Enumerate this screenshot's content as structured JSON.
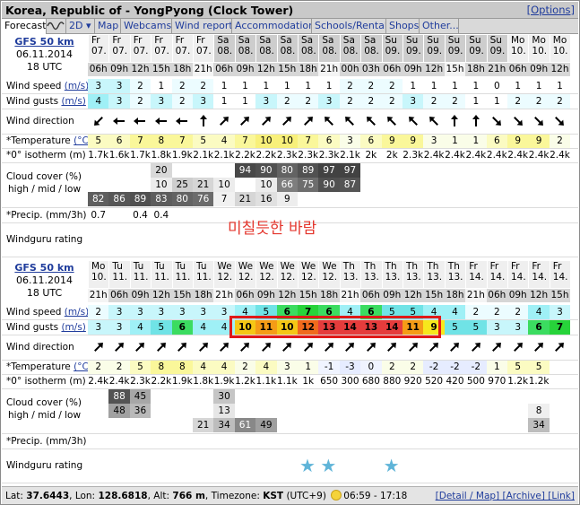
{
  "title": "Korea, Republic of - YongPyong (Clock Tower)",
  "options_label": "[Options]",
  "tabs": [
    "Forecast",
    "2D",
    "Map",
    "Webcams",
    "Wind reports",
    "Accommodation",
    "Schools/Rentals",
    "Shops",
    "Other..."
  ],
  "tab_icons": [
    "wave-chart-icon",
    "dropdown-caret-icon"
  ],
  "row_labels": {
    "wind_speed": "Wind speed",
    "wind_gusts": "Wind gusts",
    "units_ms": "(m/s)",
    "wind_direction": "Wind direction",
    "temperature": "*Temperature",
    "units_c": "(°C)",
    "isotherm": "*0° isotherm (m)",
    "cloud1": "Cloud cover (%)",
    "cloud2": "high / mid / low",
    "precip": "*Precip. (mm/3h)",
    "rating": "Windguru rating"
  },
  "annotation": "미칠듯한 바람",
  "colors": {
    "highlight": "#e01818",
    "annotation": "#e4372e",
    "star": "#5fb4d8"
  },
  "blocks": [
    {
      "model": "GFS 50 km",
      "date": "06.11.2014",
      "run": "18 UTC",
      "days": [
        "Fr",
        "Fr",
        "Fr",
        "Fr",
        "Fr",
        "Fr",
        "Sa",
        "Sa",
        "Sa",
        "Sa",
        "Sa",
        "Sa",
        "Sa",
        "Sa",
        "Su",
        "Su",
        "Su",
        "Su",
        "Su",
        "Su",
        "Mo",
        "Mo",
        "Mo"
      ],
      "dates": [
        "07.",
        "07.",
        "07.",
        "07.",
        "07.",
        "07.",
        "08.",
        "08.",
        "08.",
        "08.",
        "08.",
        "08.",
        "08.",
        "08.",
        "09.",
        "09.",
        "09.",
        "09.",
        "09.",
        "09.",
        "10.",
        "10.",
        "10."
      ],
      "hours": [
        "06h",
        "09h",
        "12h",
        "15h",
        "18h",
        "21h",
        "06h",
        "09h",
        "12h",
        "15h",
        "18h",
        "21h",
        "06h",
        "09h",
        "12h",
        "15h",
        "18h",
        "21h",
        "06h",
        "09h",
        "12h",
        "15h",
        "18h"
      ],
      "hours_fixed": [
        "06h",
        "09h",
        "12h",
        "15h",
        "18h",
        "21h",
        "06h",
        "09h",
        "12h",
        "15h",
        "18h",
        "21h",
        "00h",
        "03h",
        "06h",
        "09h",
        "12h",
        "15h",
        "18h",
        "21h",
        "06h",
        "09h",
        "12h"
      ],
      "weekend": [
        false,
        false,
        false,
        false,
        false,
        false,
        true,
        true,
        true,
        true,
        true,
        true,
        true,
        true,
        true,
        true,
        true,
        true,
        true,
        true,
        false,
        false,
        false
      ],
      "day_hours": [
        true,
        true,
        true,
        true,
        true,
        false,
        true,
        true,
        true,
        true,
        true,
        false,
        true,
        true,
        true,
        true,
        true,
        false,
        true,
        true,
        true,
        true,
        true
      ],
      "speed": [
        "3",
        "3",
        "2",
        "1",
        "2",
        "2",
        "1",
        "1",
        "1",
        "1",
        "1",
        "1",
        "2",
        "2",
        "2",
        "1",
        "1",
        "1",
        "1",
        "0",
        "1",
        "1",
        "1"
      ],
      "gusts": [
        "4",
        "3",
        "2",
        "3",
        "2",
        "3",
        "1",
        "1",
        "3",
        "2",
        "2",
        "3",
        "2",
        "2",
        "2",
        "3",
        "2",
        "2",
        "1",
        "1",
        "2",
        "2",
        "2"
      ],
      "dirs": [
        225,
        270,
        270,
        270,
        270,
        0,
        45,
        45,
        45,
        45,
        45,
        315,
        315,
        315,
        315,
        315,
        315,
        0,
        0,
        135,
        135,
        135,
        135
      ],
      "temp": [
        "5",
        "6",
        "7",
        "8",
        "7",
        "5",
        "4",
        "7",
        "10",
        "10",
        "7",
        "6",
        "3",
        "6",
        "9",
        "9",
        "3",
        "1",
        "1",
        "6",
        "9",
        "9",
        "2"
      ],
      "iso": [
        "1.7k",
        "1.6k",
        "1.7k",
        "1.8k",
        "1.9k",
        "2.1k",
        "2.1k",
        "2.2k",
        "2.2k",
        "2.3k",
        "2.3k",
        "2.3k",
        "2.1k",
        "2k",
        "2k",
        "2.3k",
        "2.4k",
        "2.4k",
        "2.4k",
        "2.4k",
        "2.4k",
        "2.4k",
        "2.4k"
      ],
      "cloud_high": [
        "",
        "",
        "",
        "20",
        "",
        "",
        "",
        "94",
        "90",
        "80",
        "89",
        "97",
        "97",
        "",
        "",
        "",
        "",
        "",
        "",
        "",
        "",
        "",
        ""
      ],
      "cloud_mid": [
        "",
        "",
        "",
        "10",
        "25",
        "21",
        "10",
        "",
        "10",
        "66",
        "75",
        "90",
        "87",
        "",
        "",
        "",
        "",
        "",
        "",
        "",
        "",
        "",
        ""
      ],
      "cloud_low": [
        "82",
        "86",
        "89",
        "83",
        "80",
        "76",
        "7",
        "21",
        "16",
        "9",
        "",
        "",
        "",
        "",
        "",
        "",
        "",
        "",
        "",
        "",
        "",
        "",
        ""
      ],
      "precip": [
        "0.7",
        "",
        "0.4",
        "0.4",
        "",
        "",
        "",
        "",
        "",
        "",
        "",
        "",
        "",
        "",
        "",
        "",
        "",
        "",
        "",
        "",
        "",
        "",
        ""
      ],
      "stars": []
    },
    {
      "model": "GFS 50 km",
      "date": "06.11.2014",
      "run": "18 UTC",
      "days": [
        "Mo",
        "Tu",
        "Tu",
        "Tu",
        "Tu",
        "Tu",
        "We",
        "We",
        "We",
        "We",
        "We",
        "We",
        "Th",
        "Th",
        "Th",
        "Th",
        "Th",
        "Th",
        "Fr",
        "Fr",
        "Fr",
        "Fr",
        "Fr"
      ],
      "dates": [
        "10.",
        "11.",
        "11.",
        "11.",
        "11.",
        "11.",
        "12.",
        "12.",
        "12.",
        "12.",
        "12.",
        "12.",
        "13.",
        "13.",
        "13.",
        "13.",
        "13.",
        "13.",
        "14.",
        "14.",
        "14.",
        "14.",
        "14."
      ],
      "hours": [
        "21h",
        "06h",
        "09h",
        "12h",
        "15h",
        "18h",
        "21h",
        "06h",
        "09h",
        "12h",
        "15h",
        "18h",
        "21h",
        "06h",
        "09h",
        "12h",
        "15h",
        "18h",
        "21h",
        "06h",
        "09h",
        "12h",
        "15h"
      ],
      "hours_fixed": [
        "21h",
        "06h",
        "09h",
        "12h",
        "15h",
        "18h",
        "21h",
        "06h",
        "09h",
        "12h",
        "15h",
        "18h",
        "21h",
        "06h",
        "09h",
        "12h",
        "15h",
        "18h",
        "21h",
        "06h",
        "09h",
        "12h",
        "15h"
      ],
      "weekend": [
        false,
        false,
        false,
        false,
        false,
        false,
        false,
        false,
        false,
        false,
        false,
        false,
        false,
        false,
        false,
        false,
        false,
        false,
        false,
        false,
        false,
        false,
        false
      ],
      "day_hours": [
        false,
        true,
        true,
        true,
        true,
        true,
        false,
        true,
        true,
        true,
        true,
        true,
        false,
        true,
        true,
        true,
        true,
        true,
        false,
        true,
        true,
        true,
        true
      ],
      "speed": [
        "2",
        "3",
        "3",
        "3",
        "3",
        "3",
        "3",
        "4",
        "5",
        "6",
        "7",
        "6",
        "4",
        "6",
        "5",
        "5",
        "4",
        "4",
        "2",
        "2",
        "2",
        "4",
        "3"
      ],
      "gusts": [
        "3",
        "3",
        "4",
        "5",
        "6",
        "4",
        "4",
        "10",
        "11",
        "10",
        "12",
        "13",
        "14",
        "13",
        "14",
        "11",
        "9",
        "5",
        "5",
        "3",
        "3",
        "6",
        "7"
      ],
      "dirs": [
        45,
        45,
        45,
        45,
        45,
        45,
        45,
        45,
        45,
        45,
        45,
        45,
        45,
        45,
        45,
        45,
        45,
        45,
        45,
        45,
        45,
        45,
        45
      ],
      "temp": [
        "2",
        "2",
        "5",
        "8",
        "8",
        "4",
        "4",
        "2",
        "4",
        "3",
        "1",
        "-1",
        "-3",
        "0",
        "2",
        "2",
        "-2",
        "-2",
        "-2",
        "1",
        "5",
        "5",
        ""
      ],
      "iso": [
        "2.4k",
        "2.4k",
        "2.3k",
        "2.2k",
        "1.9k",
        "1.8k",
        "1.9k",
        "1.2k",
        "1.1k",
        "1.1k",
        "1k",
        "650",
        "300",
        "680",
        "880",
        "920",
        "520",
        "420",
        "500",
        "970",
        "1.2k",
        "1.2k",
        ""
      ],
      "cloud_high": [
        "",
        "88",
        "45",
        "",
        "",
        "",
        "30",
        "",
        "",
        "",
        "",
        "",
        "",
        "",
        "",
        "",
        "",
        "",
        "",
        "",
        "",
        "",
        ""
      ],
      "cloud_mid": [
        "",
        "48",
        "36",
        "",
        "",
        "",
        "13",
        "",
        "",
        "",
        "",
        "",
        "",
        "",
        "",
        "",
        "",
        "",
        "",
        "",
        "",
        "8",
        ""
      ],
      "cloud_low": [
        "",
        "",
        "",
        "",
        "",
        "21",
        "34",
        "61",
        "49",
        "",
        "",
        "",
        "",
        "",
        "",
        "",
        "",
        "",
        "",
        "",
        "",
        "34",
        ""
      ],
      "precip": [
        "",
        "",
        "",
        "",
        "",
        "",
        "",
        "",
        "",
        "",
        "",
        "",
        "",
        "",
        "",
        "",
        "",
        "",
        "",
        "",
        "",
        "",
        ""
      ],
      "stars": [
        10,
        11,
        14
      ]
    }
  ],
  "footer": {
    "lat_label": "Lat:",
    "lat": "37.6443",
    "lon_label": "Lon:",
    "lon": "128.6818",
    "alt_label": "Alt:",
    "alt": "766 m",
    "tz_label": "Timezone:",
    "tz": "KST",
    "tz_offset": "(UTC+9)",
    "sun_times": "06:59 - 17:18",
    "links": "[Detail / Map] [Archive] [Link]"
  }
}
